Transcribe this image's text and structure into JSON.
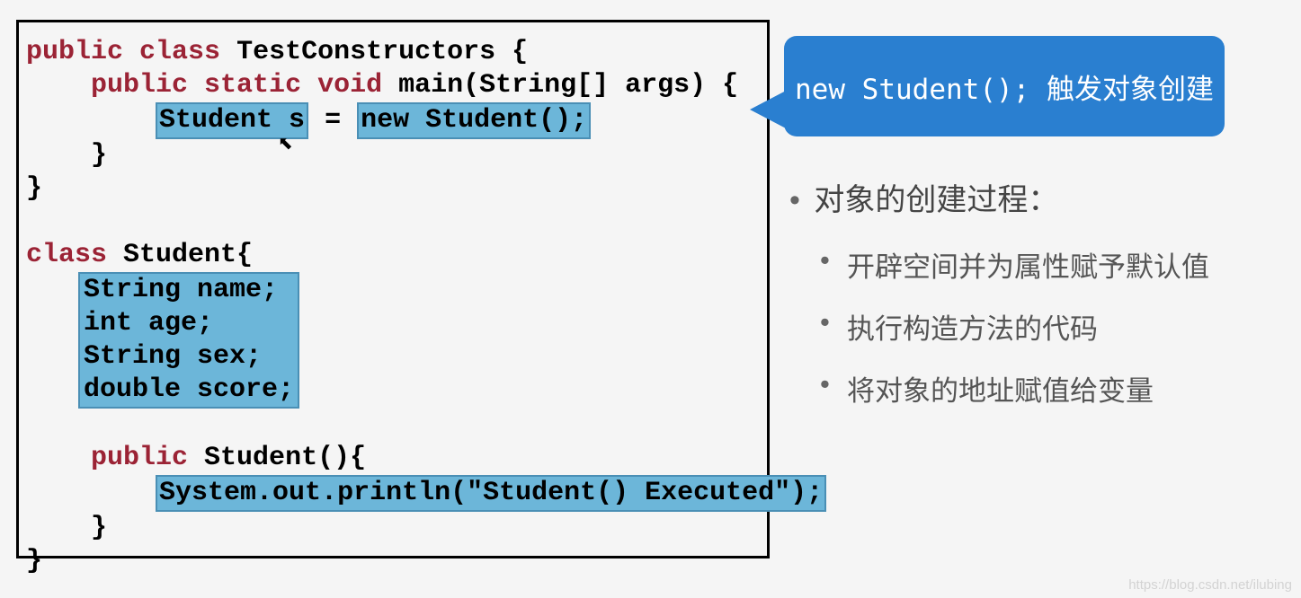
{
  "code": {
    "l1a": "public",
    "l1b": " class",
    "l1c": " TestConstructors {",
    "l2a": "public",
    "l2b": " static",
    "l2c": " void",
    "l2d": " main(String[] args) {",
    "l3a": "Student s",
    "l3b": " = ",
    "l3c": "new Student();",
    "l4": "    }",
    "l5": "}",
    "l6a": "class",
    "l6b": " Student{",
    "fields": [
      "String name;",
      "int age;",
      "String sex;",
      "double score;"
    ],
    "l10a": "public",
    "l10b": " Student(){",
    "l11": "System.out.println(\"Student() Executed\");",
    "l12": "    }",
    "l13": "}"
  },
  "callout": {
    "text": "new Student(); 触发对象创建"
  },
  "notes": {
    "title": "对象的创建过程：",
    "items": [
      "开辟空间并为属性赋予默认值",
      "执行构造方法的代码",
      "将对象的地址赋值给变量"
    ]
  },
  "watermark": "https://blog.csdn.net/ilubing"
}
